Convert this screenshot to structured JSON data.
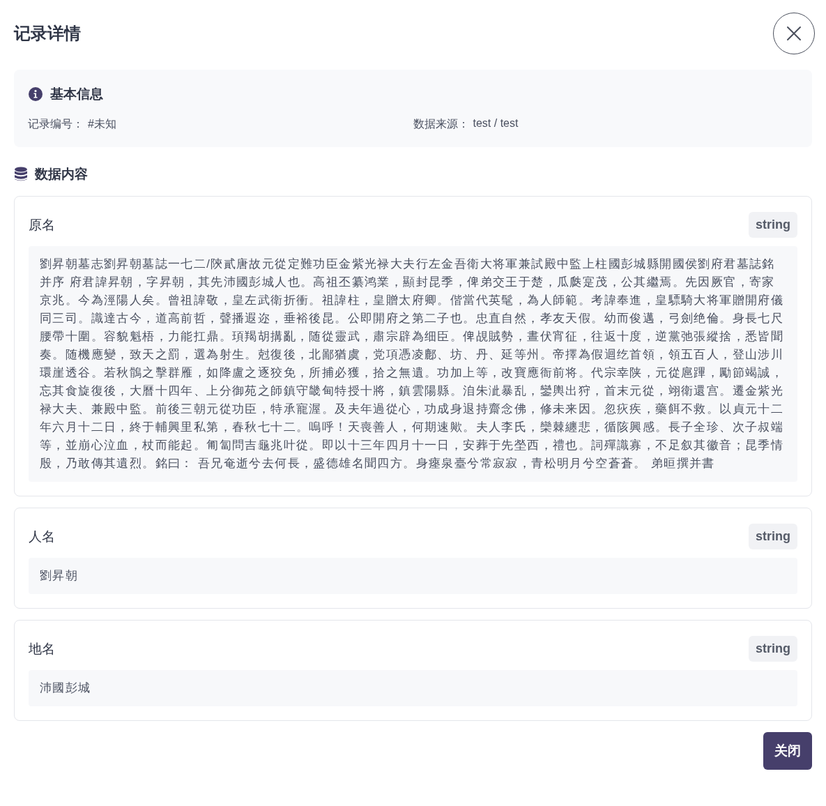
{
  "dialog": {
    "title": "记录详情"
  },
  "basic_info": {
    "title": "基本信息",
    "fields": [
      {
        "label": "记录编号：",
        "value": "#未知"
      },
      {
        "label": "数据来源：",
        "value": "test / test"
      }
    ]
  },
  "data_content": {
    "title": "数据内容",
    "fields": [
      {
        "name": "原名",
        "type": "string",
        "value": "劉昇朝墓志劉昇朝墓誌一七二/陝貳唐故元從定難功臣金紫光禄大夫行左金吾衛大将軍兼試殿中監上柱國彭城縣開國侯劉府君墓誌銘并序 府君諱昇朝，字昇朝，其先沛國彭城人也。高祖丕纂鸿業，顯封昆季，俾弟交王于楚，瓜瓞寔茂，公其繼焉。先因厥官，寄家京兆。今為涇陽人矣。曾祖諱敬，皇左武衛折衝。祖諱柱，皇贈太府卿。偕當代英髦，為人師範。考諱奉進，皇驃騎大将軍贈開府儀同三司。識達古今，道高前哲，聲播遐迩，垂裕後昆。公即開府之第二子也。忠直自然，孝友天假。幼而俊邁，弓劍绝倫。身長七尺腰帶十圍。容貌魁梧，力能扛鼎。頊羯胡搆亂，随從靈武，肅宗辟為细臣。俾覘賊勢，晝伏宵征，往返十度，逆黨弛張縱捨，悉皆聞奏。随機應變，致天之罰，選為射生。尅復後，北鄙猶虞，党項憑凌鄜、坊、丹、延等州。帝擇為假迴纥首領，領五百人，登山涉川環崖透谷。若秋鶻之擊群雁，如降盧之逐狡免，所捕必獲，拾之無遺。功加上等，改寶應衙前将。代宗幸陕，元從扈蹕，勵節竭誠，忘其食旋復後，大曆十四年、上分御苑之師鎮守畿甸特授十將，鎮雲陽縣。洎朱泚暴乱，鑾輿出狩，首末元從，翊衛還宫。遷金紫光禄大夫、兼殿中監。前後三朝元從功臣，特承寵渥。及夫年過從心，功成身退持齋念佛，修未来因。忽疢疾，藥餌不救。以貞元十二年六月十二日，終于輔興里私第，春秋七十二。嗚呼！天喪善人，何期速歟。夫人李氏，欒棘纏悲，循陔興感。長子全珍、次子叔端等，並崩心泣血，杖而能起。匍匐問吉龜兆叶從。即以十三年四月十一日，安葬于先塋西，禮也。詞殫識寡，不足叙其徽音；昆季情殷，乃敢傳其遺烈。銘曰： 吾兄奄逝兮去何長，盛德雄名聞四方。身瘞泉臺兮常寂寂，青松明月兮空蒼蒼。 弟晅撰并書"
      },
      {
        "name": "人名",
        "type": "string",
        "value": "劉昇朝"
      },
      {
        "name": "地名",
        "type": "string",
        "value": "沛國彭城"
      }
    ]
  },
  "footer": {
    "button": "关闭"
  }
}
